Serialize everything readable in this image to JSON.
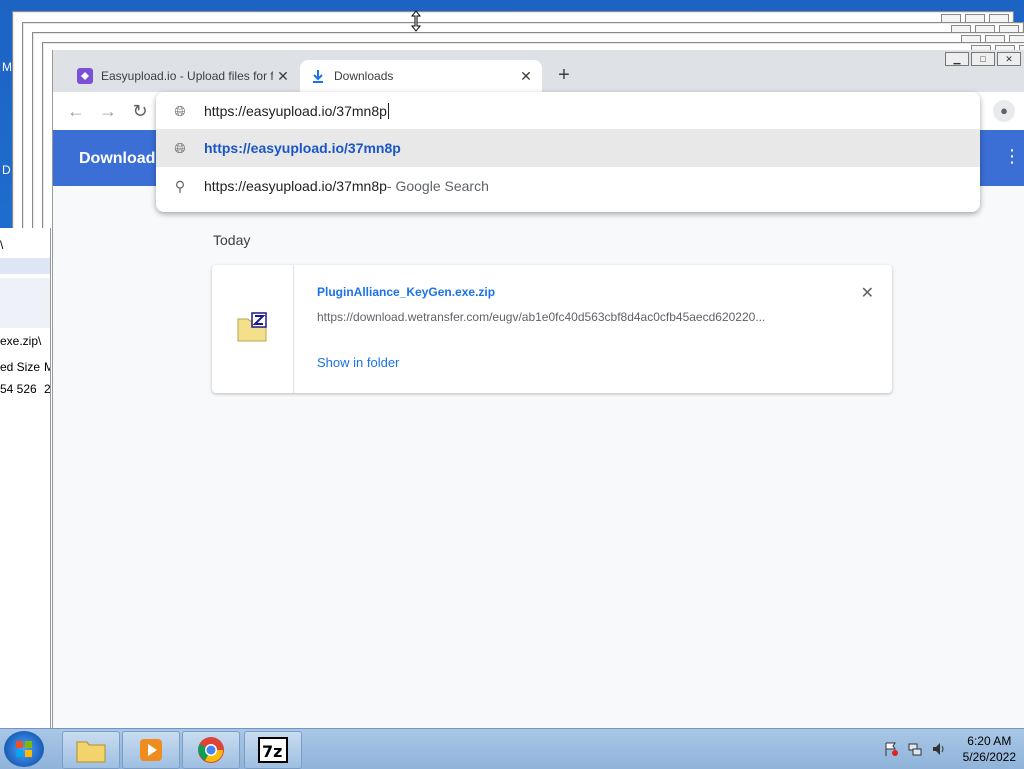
{
  "tabs": [
    {
      "title": "Easyupload.io - Upload files for f",
      "active": false
    },
    {
      "title": "Downloads",
      "active": true
    }
  ],
  "omnibox": {
    "input_value": "https://easyupload.io/37mn8p",
    "suggestion_url": "https://easyupload.io/37mn8p",
    "search_query": "https://easyupload.io/37mn8p",
    "search_suffix": " - Google Search"
  },
  "downloads": {
    "header_title": "Downloads",
    "section_label": "Today",
    "item": {
      "filename": "PluginAlliance_KeyGen.exe.zip",
      "url": "https://download.wetransfer.com/eugv/ab1e0fc40d563cbf8d4ac0cfb45aecd620220...",
      "show_in_folder": "Show in folder"
    }
  },
  "zip_window": {
    "path_fragment": "exe.zip\\",
    "col_header_fragment": "ed Size",
    "col_header_fragment2": "M",
    "row_value_fragment": "54 526",
    "row_value_fragment2": "2",
    "top_fragment": "\\"
  },
  "desktop_glyphs": [
    "M",
    "D"
  ],
  "taskbar": {
    "time": "6:20 AM",
    "date": "5/26/2022"
  },
  "colors": {
    "accent": "#1a73e8",
    "header_bg": "#3b6fd6",
    "taskbar": "#9ebfe2"
  }
}
